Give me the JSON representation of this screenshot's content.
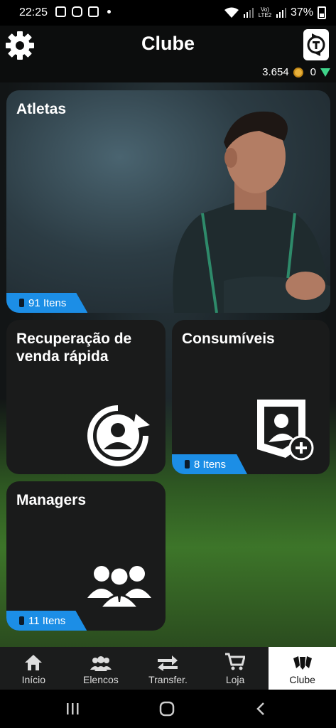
{
  "status": {
    "time": "22:25",
    "signal_label": "Vo) LTE2",
    "battery": "37%"
  },
  "header": {
    "title": "Clube",
    "coins": "3.654",
    "points": "0"
  },
  "cards": {
    "athletes": {
      "title": "Atletas",
      "count": "91 Itens"
    },
    "recovery": {
      "title_line1": "Recuperação de",
      "title_line2": "venda rápida"
    },
    "consumables": {
      "title": "Consumíveis",
      "count": "8 Itens"
    },
    "managers": {
      "title": "Managers",
      "count": "11 Itens"
    }
  },
  "nav": {
    "tabs": [
      {
        "label": "Início",
        "icon": "home-icon"
      },
      {
        "label": "Elencos",
        "icon": "squads-icon"
      },
      {
        "label": "Transfer.",
        "icon": "transfer-icon"
      },
      {
        "label": "Loja",
        "icon": "cart-icon"
      },
      {
        "label": "Clube",
        "icon": "club-icon",
        "active": true
      }
    ]
  },
  "colors": {
    "accent": "#1c8ee6",
    "coin": "#e8b13c",
    "points": "#3fd48a"
  }
}
